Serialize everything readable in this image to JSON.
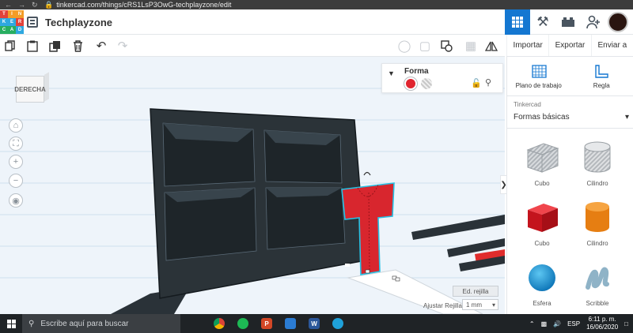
{
  "browser": {
    "url": "tinkercad.com/things/cRS1LsP3OwG-techplayzone/edit"
  },
  "logo": {
    "letters": [
      "T",
      "I",
      "N",
      "K",
      "E",
      "R",
      "C",
      "A",
      "D"
    ],
    "colors": [
      "#e2423a",
      "#f39c26",
      "#f39c26",
      "#2fa8e0",
      "#2fa8e0",
      "#e2423a",
      "#27ae60",
      "#27ae60",
      "#2fa8e0"
    ]
  },
  "header": {
    "project_name": "Techplayzone"
  },
  "top_actions": {
    "importar": "Importar",
    "exportar": "Exportar",
    "enviar": "Enviar a"
  },
  "view_cube": {
    "label": "DERECHA"
  },
  "shape_panel": {
    "title": "Forma",
    "solid_color": "#e0252f"
  },
  "grid_controls": {
    "edit_label": "Ed. rejilla",
    "snap_label": "Ajustar Rejilla",
    "snap_value": "1 mm"
  },
  "library": {
    "workplane_label": "Plano de trabajo",
    "ruler_label": "Regla",
    "source": "Tinkercad",
    "category": "Formas básicas",
    "shapes": [
      {
        "label": "Cubo",
        "kind": "striped-box"
      },
      {
        "label": "Cilindro",
        "kind": "striped-cylinder"
      },
      {
        "label": "Cubo",
        "kind": "red-box"
      },
      {
        "label": "Cilindro",
        "kind": "orange-cylinder"
      },
      {
        "label": "Esfera",
        "kind": "blue-sphere"
      },
      {
        "label": "Scribble",
        "kind": "scribble"
      }
    ]
  },
  "taskbar": {
    "search_placeholder": "Escribe aquí para buscar",
    "language": "ESP",
    "time": "6:11 p. m.",
    "date": "16/06/2020"
  }
}
